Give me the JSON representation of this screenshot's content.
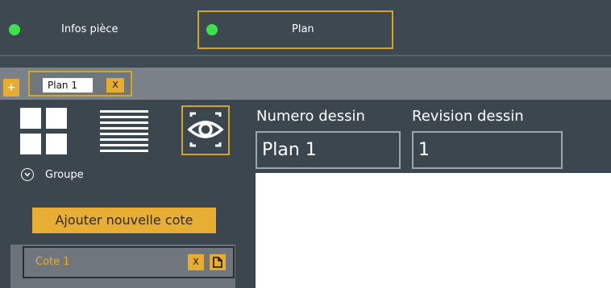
{
  "tabs": {
    "infos": {
      "label": "Infos pièce",
      "status_color": "#3fe04e"
    },
    "plan": {
      "label": "Plan",
      "status_color": "#3fe04e",
      "active": true
    }
  },
  "subtabs": {
    "add_label": "+",
    "items": [
      {
        "label": "Plan 1",
        "close_label": "X"
      }
    ]
  },
  "toolbar": {
    "icons": [
      "grid-view-icon",
      "list-view-icon",
      "eye-icon"
    ]
  },
  "fields": {
    "numero": {
      "label": "Numero dessin",
      "value": "Plan 1"
    },
    "revision": {
      "label": "Revision dessin",
      "value": "1"
    }
  },
  "group": {
    "label": "Groupe",
    "icon": "chevron-down-icon"
  },
  "add_button": {
    "label": "Ajouter nouvelle cote"
  },
  "cotes": [
    {
      "label": "Cote 1",
      "close_label": "X",
      "icon": "duplicate-icon"
    }
  ],
  "colors": {
    "accent": "#e8ad2f",
    "status_ok": "#3fe04e",
    "background": "#3b464e"
  }
}
